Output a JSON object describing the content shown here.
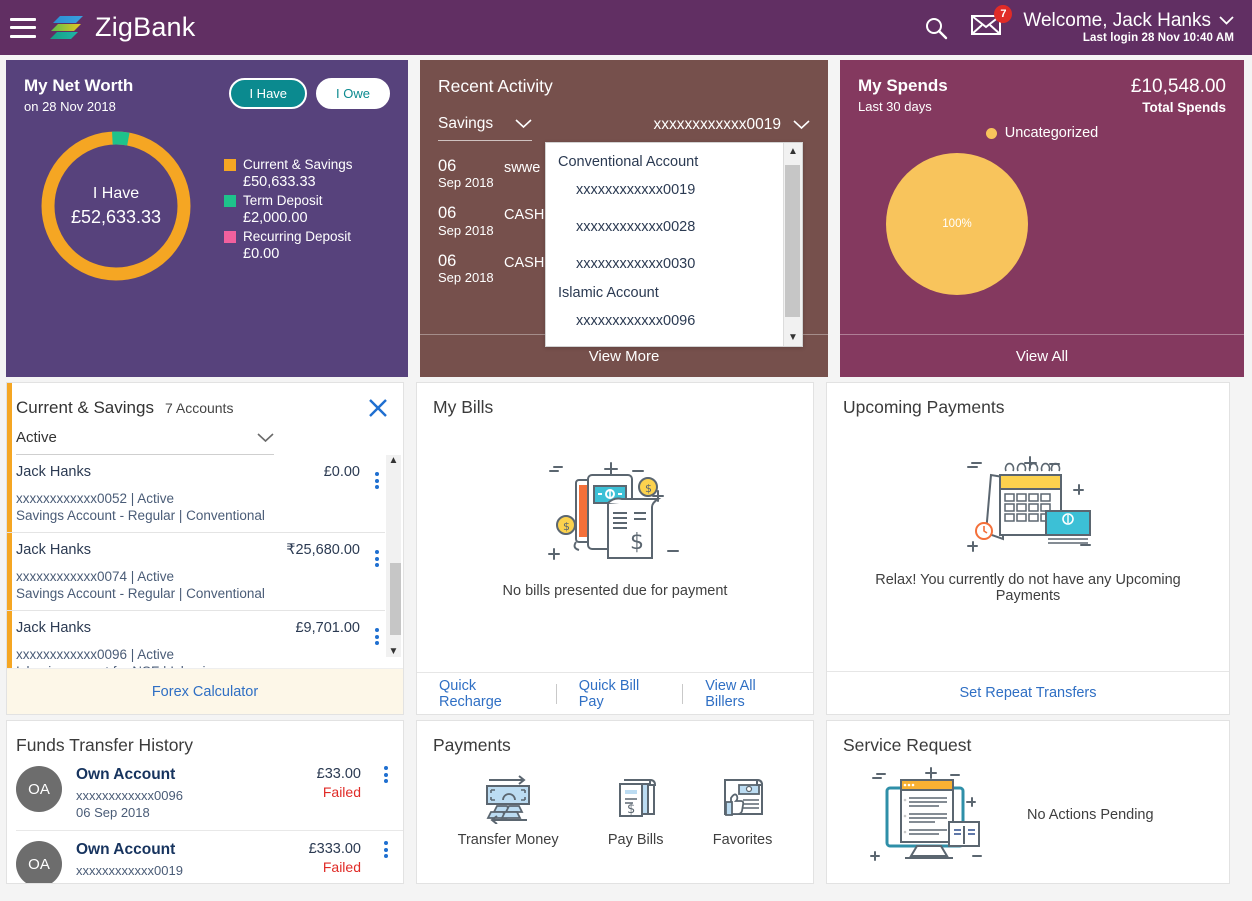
{
  "header": {
    "brand": "ZigBank",
    "menu_icon": "hamburger-icon",
    "search_icon": "search-icon",
    "mail_icon": "mail-icon",
    "mail_badge": "7",
    "welcome": "Welcome, Jack Hanks",
    "last_login": "Last login 28 Nov 10:40 AM"
  },
  "net_worth": {
    "title": "My Net Worth",
    "subtitle": "on 28 Nov 2018",
    "toggle_have": "I Have",
    "toggle_owe": "I Owe",
    "center_label": "I Have",
    "center_value": "£52,633.33",
    "legend": [
      {
        "label": "Current & Savings",
        "amount": "£50,633.33",
        "color": "#f5a623"
      },
      {
        "label": "Term Deposit",
        "amount": "£2,000.00",
        "color": "#1ec28b"
      },
      {
        "label": "Recurring Deposit",
        "amount": "£0.00",
        "color": "#f2609e"
      }
    ],
    "chart_data": {
      "type": "pie",
      "title": "My Net Worth",
      "categories": [
        "Current & Savings",
        "Term Deposit",
        "Recurring Deposit"
      ],
      "values": [
        50633.33,
        2000.0,
        0.0
      ],
      "colors": [
        "#f5a623",
        "#1ec28b",
        "#f2609e"
      ],
      "total": 52633.33,
      "legend_position": "right"
    }
  },
  "recent_activity": {
    "title": "Recent Activity",
    "type_select": "Savings",
    "account_select": "xxxxxxxxxxxx0019",
    "items": [
      {
        "day": "06",
        "month": "Sep 2018",
        "desc": "swwe"
      },
      {
        "day": "06",
        "month": "Sep 2018",
        "desc": "CASH"
      },
      {
        "day": "06",
        "month": "Sep 2018",
        "desc": "CASH"
      }
    ],
    "footer": "View More",
    "dropdown": {
      "groups": [
        {
          "label": "Conventional Account",
          "options": [
            "xxxxxxxxxxxx0019",
            "xxxxxxxxxxxx0028",
            "xxxxxxxxxxxx0030"
          ]
        },
        {
          "label": "Islamic Account",
          "options": [
            "xxxxxxxxxxxx0096"
          ]
        }
      ],
      "scroll_up": "▲",
      "scroll_down": "▼"
    }
  },
  "my_spends": {
    "title": "My Spends",
    "subtitle": "Last 30 days",
    "total": "£10,548.00",
    "total_label": "Total Spends",
    "legend_label": "Uncategorized",
    "slice_label": "100%",
    "footer": "View All",
    "chart_data": {
      "type": "pie",
      "title": "My Spends",
      "subtitle": "Last 30 days",
      "categories": [
        "Uncategorized"
      ],
      "values": [
        100
      ],
      "value_unit": "percent",
      "total_amount": "£10,548.00",
      "colors": [
        "#f8c45c"
      ],
      "legend_position": "top"
    }
  },
  "current_savings": {
    "title": "Current & Savings",
    "count": "7 Accounts",
    "close_icon": "close-icon",
    "filter": "Active",
    "accounts": [
      {
        "name": "Jack Hanks",
        "balance": "£0.00",
        "line1": "xxxxxxxxxxxx0052 | Active",
        "line2": "Savings Account - Regular | Conventional"
      },
      {
        "name": "Jack Hanks",
        "balance": "₹25,680.00",
        "line1": "xxxxxxxxxxxx0074 | Active",
        "line2": "Savings Account - Regular | Conventional"
      },
      {
        "name": "Jack Hanks",
        "balance": "£9,701.00",
        "line1": "xxxxxxxxxxxx0096 | Active",
        "line2": "Islamic account for NSF | Islamic"
      }
    ],
    "footer": "Forex Calculator"
  },
  "my_bills": {
    "title": "My Bills",
    "empty_text": "No bills presented due for payment",
    "links": [
      "Quick Recharge",
      "Quick Bill Pay",
      "View All Billers"
    ]
  },
  "upcoming_payments": {
    "title": "Upcoming Payments",
    "empty_text": "Relax! You currently do not have any Upcoming Payments",
    "footer": "Set Repeat Transfers"
  },
  "funds_transfer_history": {
    "title": "Funds Transfer History",
    "rows": [
      {
        "avatar": "OA",
        "title": "Own Account",
        "account": "xxxxxxxxxxxx0096",
        "date": "06 Sep 2018",
        "amount": "£33.00",
        "status": "Failed"
      },
      {
        "avatar": "OA",
        "title": "Own Account",
        "account": "xxxxxxxxxxxx0019",
        "date": "",
        "amount": "£333.00",
        "status": "Failed"
      }
    ]
  },
  "payments": {
    "title": "Payments",
    "items": [
      {
        "label": "Transfer Money",
        "icon": "transfer-money-icon"
      },
      {
        "label": "Pay Bills",
        "icon": "pay-bills-icon"
      },
      {
        "label": "Favorites",
        "icon": "favorites-icon"
      }
    ]
  },
  "service_request": {
    "title": "Service Request",
    "empty_text": "No Actions Pending"
  }
}
